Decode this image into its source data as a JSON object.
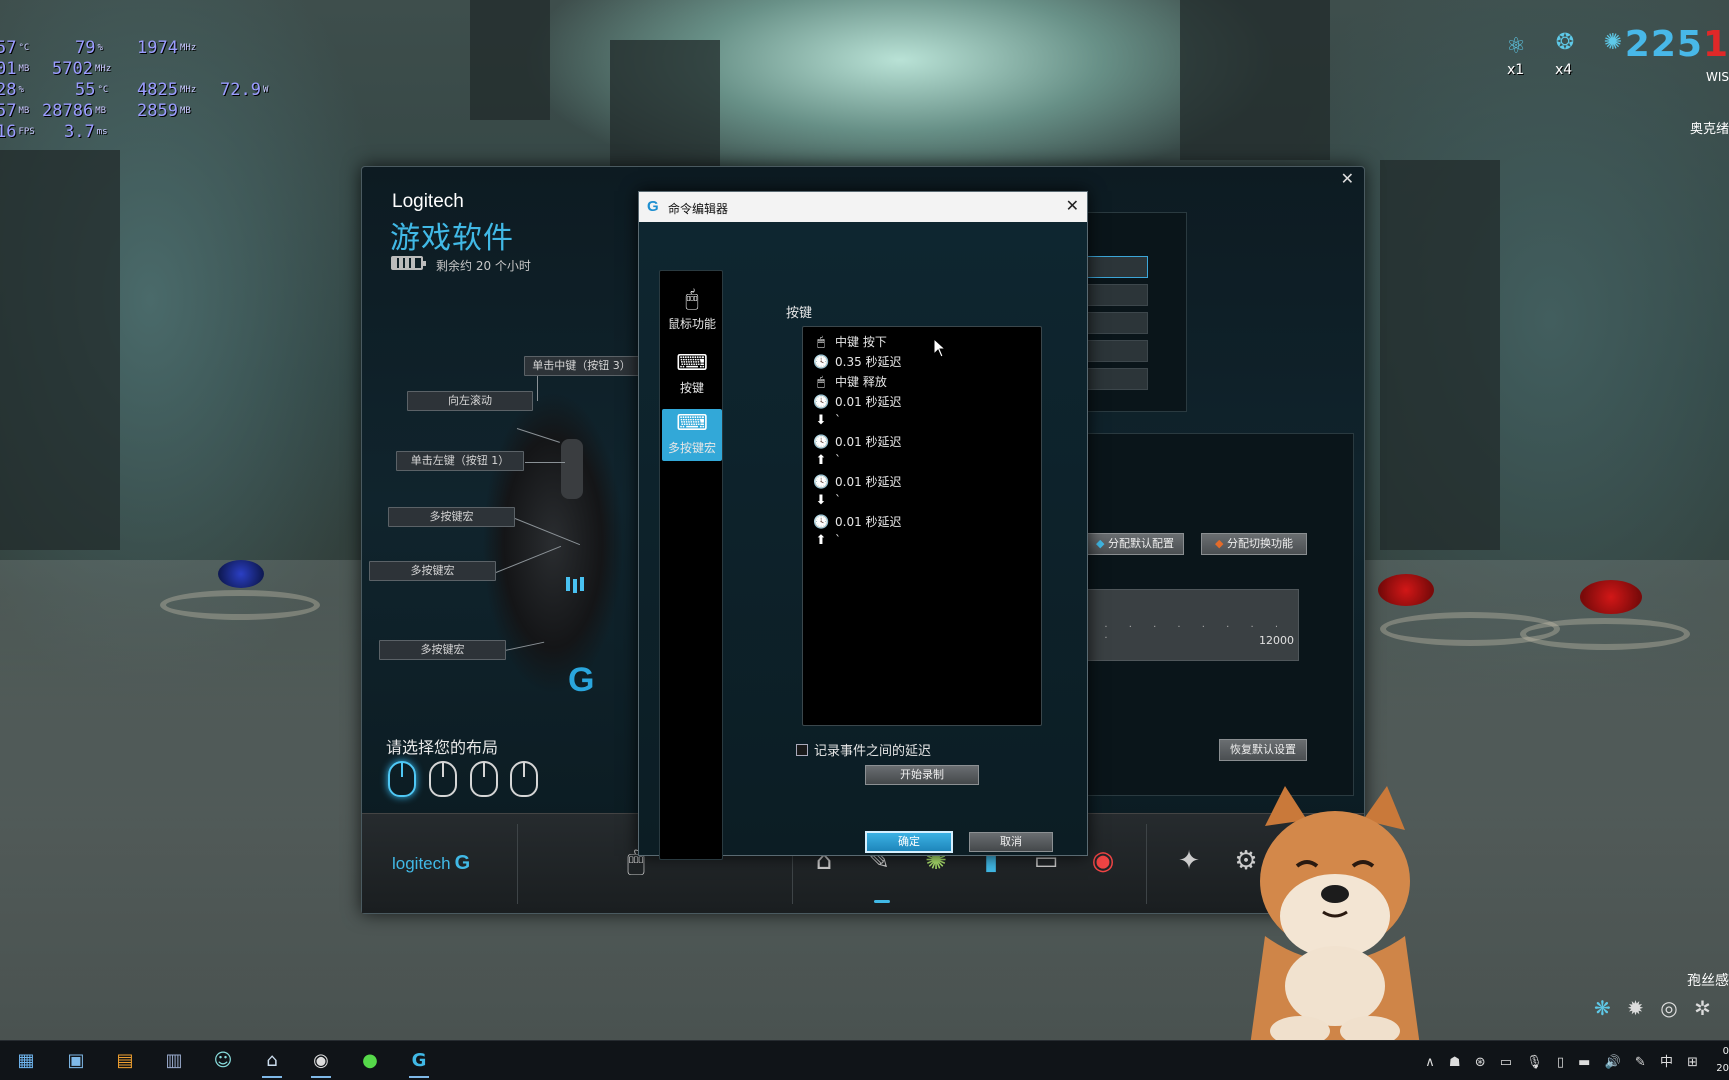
{
  "hud": {
    "stats": [
      {
        "a": "57",
        "au": "°C",
        "b": "79",
        "bu": "%",
        "c": "1974",
        "cu": "MHz"
      },
      {
        "a": "01",
        "au": "MB",
        "b": "5702",
        "bu": "MHz",
        "c": "",
        "cu": ""
      },
      {
        "a": "28",
        "au": "%",
        "b": "55",
        "bu": "°C",
        "c": "4825",
        "cu": "MHz",
        "d": "72.9",
        "du": "W"
      },
      {
        "a": "57",
        "au": "MB",
        "b": "28786",
        "bu": "MB",
        "c": "2859",
        "cu": "MB"
      },
      {
        "a": "16",
        "au": "FPS",
        "b": "3.7",
        "bu": "ms",
        "c": "",
        "cu": ""
      }
    ],
    "counters": [
      "x1",
      "x4"
    ],
    "score_main": "225",
    "score_red": "1",
    "score_sub": "WIS",
    "player_name": "奥克绪",
    "bottom_right_text": "孢丝感"
  },
  "lgs": {
    "brand": "Logitech",
    "title": "游戏软件",
    "battery_text": "剩余约 20 个小时",
    "battery_level": 0.8,
    "callouts": {
      "middle_click": "单击中键（按钮 3）",
      "scroll_left": "向左滚动",
      "left_click": "单击左键（按钮 1）",
      "macro1": "多按键宏",
      "macro2": "多按键宏",
      "macro3": "多按键宏"
    },
    "layout_label": "请选择您的布局",
    "assign_default": "分配默认配置",
    "assign_switch": "分配切换功能",
    "slider_value": "12000",
    "restore_default": "恢复默认设置",
    "wordmark": "logitech",
    "colors": {
      "accent": "#41b9e6",
      "window": "#0d1b22"
    }
  },
  "dialog": {
    "title": "命令编辑器",
    "side": {
      "mouse_function": "鼠标功能",
      "keystroke": "按键",
      "multikey_macro": "多按键宏"
    },
    "keys_label": "按键",
    "macro_items": [
      {
        "icon": "mouse-icon",
        "glyph": "🖱",
        "text": "中键 按下"
      },
      {
        "icon": "clock-icon",
        "glyph": "🕓",
        "text": "0.35 秒延迟"
      },
      {
        "icon": "mouse-icon",
        "glyph": "🖱",
        "text": "中键 释放"
      },
      {
        "icon": "clock-icon",
        "glyph": "🕓",
        "text": "0.01 秒延迟"
      },
      {
        "icon": "arrow-down-icon",
        "glyph": "⬇",
        "text": "`"
      },
      {
        "icon": "clock-icon",
        "glyph": "🕓",
        "text": "0.01 秒延迟"
      },
      {
        "icon": "arrow-up-icon",
        "glyph": "⬆",
        "text": "`"
      },
      {
        "icon": "clock-icon",
        "glyph": "🕓",
        "text": "0.01 秒延迟"
      },
      {
        "icon": "arrow-down-icon",
        "glyph": "⬇",
        "text": "`"
      },
      {
        "icon": "clock-icon",
        "glyph": "🕓",
        "text": "0.01 秒延迟"
      },
      {
        "icon": "arrow-up-icon",
        "glyph": "⬆",
        "text": "`"
      }
    ],
    "record_delays_label": "记录事件之间的延迟",
    "record_delays_checked": false,
    "start_record": "开始录制",
    "ok": "确定",
    "cancel": "取消"
  },
  "tray": {
    "ime": "中",
    "date_fragment": "20",
    "time_fragment": "0"
  }
}
